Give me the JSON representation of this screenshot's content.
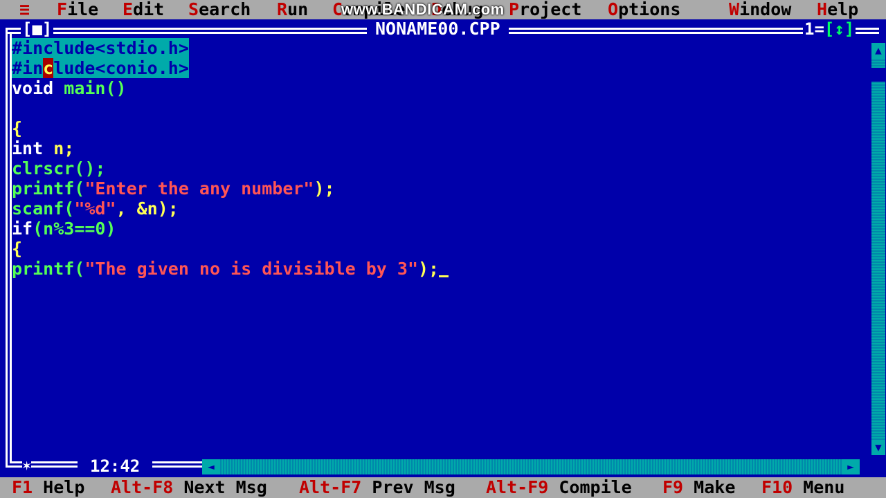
{
  "menu": {
    "system": "≡",
    "file": {
      "hot": "F",
      "rest": "ile"
    },
    "edit": {
      "hot": "E",
      "rest": "dit"
    },
    "search": {
      "hot": "S",
      "rest": "earch"
    },
    "run": {
      "hot": "R",
      "rest": "un"
    },
    "compile": {
      "hot": "C",
      "rest": "ompile"
    },
    "debug": {
      "hot": "D",
      "rest": "ebug"
    },
    "project": {
      "hot": "P",
      "rest": "roject"
    },
    "options": {
      "hot": "O",
      "rest": "ptions"
    },
    "window": {
      "hot": "W",
      "rest": "indow"
    },
    "help": {
      "hot": "H",
      "rest": "elp"
    }
  },
  "watermark": "www.BANDICAM.com",
  "window": {
    "title": "NONAME00.CPP",
    "close_box": "[■]",
    "number": "1",
    "zoom": "[↕]"
  },
  "code": {
    "l1": "#include<stdio.h>",
    "l2a": "#in",
    "l2b": "c",
    "l2c": "lude<conio.h>",
    "l3a": "void ",
    "l3b": "main()",
    "l5": "{",
    "l6a": "int ",
    "l6b": "n;",
    "l7": "clrscr();",
    "l8a": "printf(",
    "l8b": "\"Enter the any number\"",
    "l8c": ");",
    "l9a": "scanf(",
    "l9b": "\"%d\"",
    "l9c": ", &n);",
    "l10a": "if",
    "l10b": "(n%3==0)",
    "l11": "{",
    "l12a": "printf(",
    "l12b": "\"The given no is divisible by 3\"",
    "l12c": ");"
  },
  "status": {
    "position": "12:42",
    "modified_icon": "✶"
  },
  "keys": [
    {
      "key": "F1",
      "label": " Help"
    },
    {
      "key": "Alt-F8",
      "label": " Next Msg"
    },
    {
      "key": "Alt-F7",
      "label": " Prev Msg"
    },
    {
      "key": "Alt-F9",
      "label": " Compile"
    },
    {
      "key": "F9",
      "label": " Make"
    },
    {
      "key": "F10",
      "label": " Menu"
    }
  ],
  "colors": {
    "background": "#0000aa",
    "menubar": "#aaaaaa",
    "hotkey": "#c00000",
    "selection": "#00aaaa",
    "string": "#ff5555",
    "identifier": "#ffff55"
  }
}
